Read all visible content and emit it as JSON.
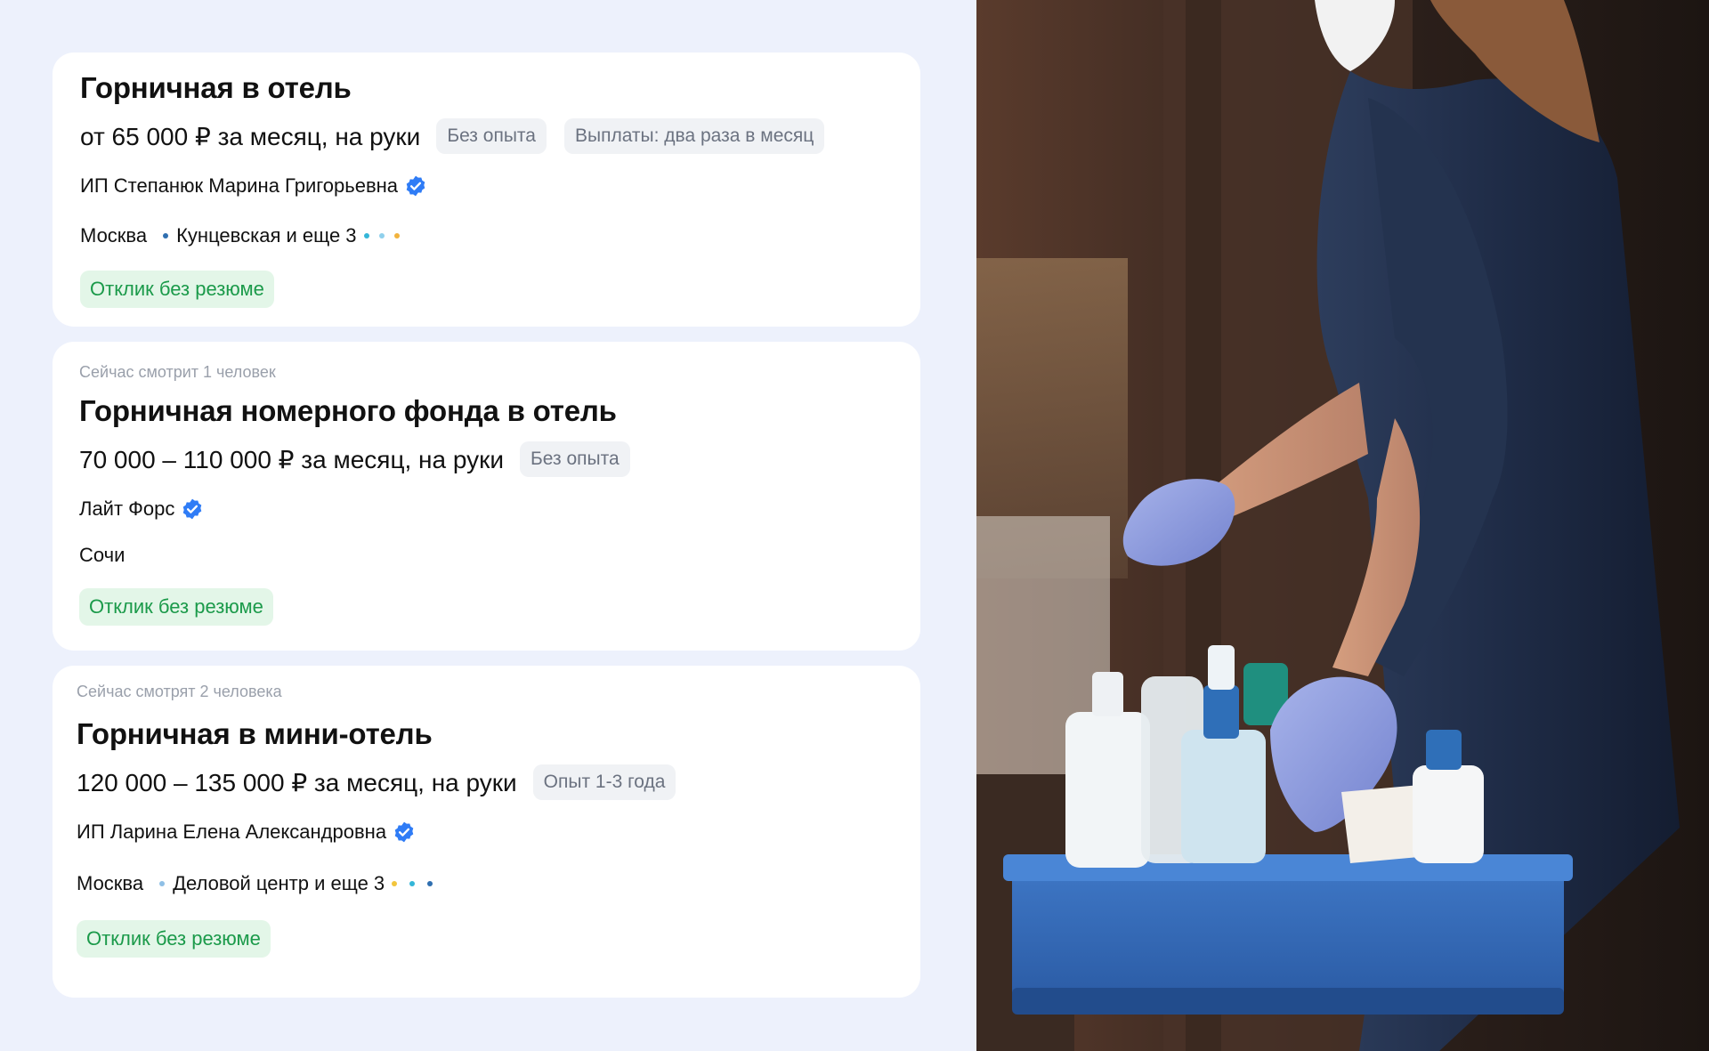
{
  "vacancies": [
    {
      "viewers": "",
      "title": "Горничная в отель",
      "salary": "от 65 000 ₽ за месяц, на руки",
      "chips": [
        "Без опыта",
        "Выплаты: два раза в месяц"
      ],
      "company": "ИП Степанюк Марина Григорьевна",
      "city": "Москва",
      "metro": "Кунцевская и еще 3",
      "metro_color": "#2f6fb0",
      "extra_colors": [
        "#34b6d8",
        "#8fd0ec",
        "#f2b33d"
      ],
      "apply": "Отклик без резюме"
    },
    {
      "viewers": "Сейчас смотрит 1 человек",
      "title": "Горничная номерного фонда в отель",
      "salary": "70 000 – 110 000 ₽ за месяц, на руки",
      "chips": [
        "Без опыта"
      ],
      "company": "Лайт Форс",
      "city": "Сочи",
      "apply": "Отклик без резюме"
    },
    {
      "viewers": "Сейчас смотрят 2 человека",
      "title": "Горничная в мини-отель",
      "salary": "120 000 – 135 000 ₽ за месяц, на руки",
      "chips": [
        "Опыт 1-3 года"
      ],
      "company": "ИП Ларина Елена Александровна",
      "city": "Москва",
      "metro": "Деловой центр и еще 3",
      "metro_color": "#8fc0e6",
      "extra_colors": [
        "#f2c53d",
        "#34b6d8",
        "#2f6fb0"
      ],
      "apply": "Отклик без резюме"
    }
  ],
  "colors": {
    "verified": "#2f7cf6",
    "apply_bg": "#e3f6e8",
    "apply_text": "#1b9a4a",
    "chip_bg": "#f0f2f5",
    "page_bg": "#edf1fc"
  },
  "photo": {
    "subject": "housekeeper-with-cleaning-caddy"
  }
}
